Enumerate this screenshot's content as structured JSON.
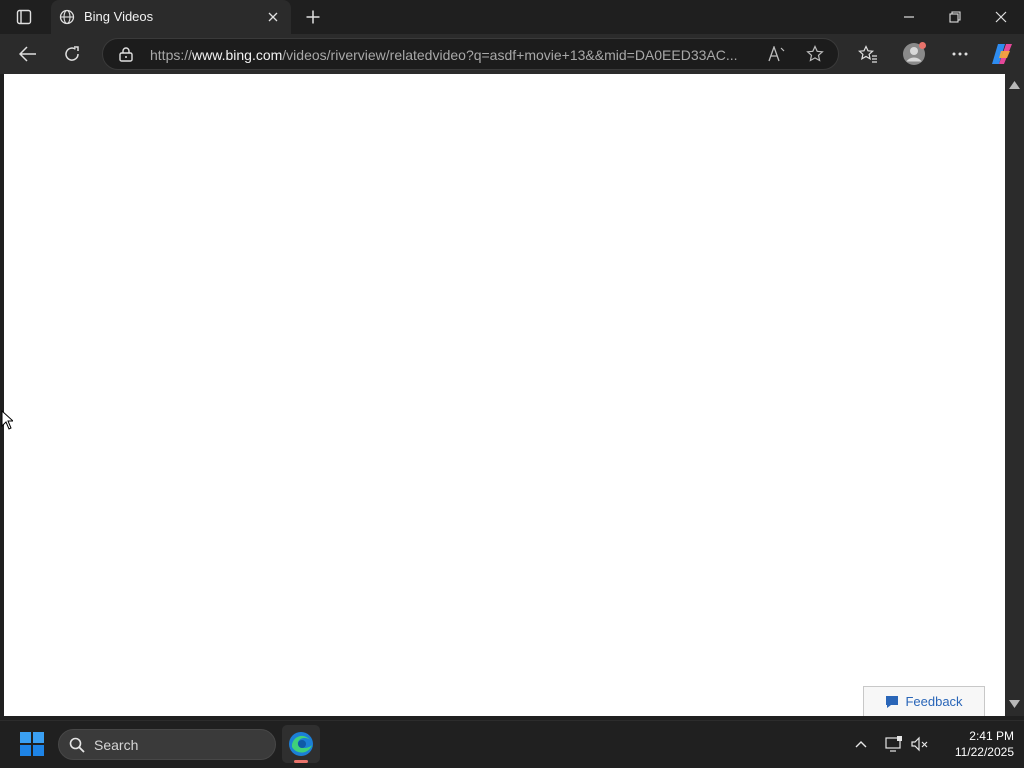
{
  "browser": {
    "tab": {
      "title": "Bing Videos",
      "close_icon": "close-icon"
    },
    "address": {
      "url_prefix": "https://",
      "url_host": "www.bing.com",
      "url_path": "/videos/riverview/relatedvideo?q=asdf+movie+13&&mid=DA0EED33AC..."
    },
    "icons": {
      "tab_actions": "tab-actions-icon",
      "globe": "globe-icon",
      "new_tab": "plus-icon",
      "minimize": "minimize-icon",
      "restore": "restore-icon",
      "close": "close-window-icon",
      "back": "back-arrow-icon",
      "refresh": "refresh-icon",
      "lock": "lock-icon",
      "read_aloud": "read-aloud-icon",
      "favorite": "star-icon",
      "favorites": "favorites-icon",
      "profile": "profile-icon",
      "more": "more-icon",
      "copilot": "copilot-icon"
    }
  },
  "page": {
    "feedback_label": "Feedback"
  },
  "taskbar": {
    "search_label": "Search",
    "time": "2:41 PM",
    "date": "11/22/2025"
  },
  "colors": {
    "browser_chrome": "#2b2b2b",
    "titlebar": "#1f1f1f",
    "taskbar": "#202020",
    "feedback_text": "#2a66b8",
    "windows_blue": "#1e90ff"
  }
}
